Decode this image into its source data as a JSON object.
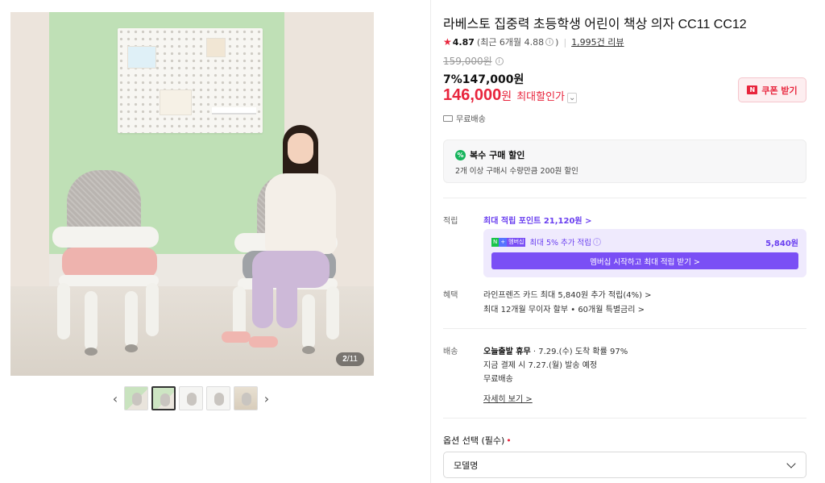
{
  "gallery": {
    "counter_current": "2",
    "counter_total": "/11",
    "prev_icon": "chevron-left-icon",
    "next_icon": "chevron-right-icon",
    "thumbnail_count": 5,
    "active_thumbnail": 2
  },
  "product": {
    "title": "라베스토 집중력 초등학생 어린이 책상 의자 CC11 CC12",
    "rating": "4.87",
    "rating_recent": "(최근 6개월 4.88",
    "rating_recent_close": ")",
    "review_count": "1,995건 리뷰",
    "original_price": "159,000원",
    "sale_price_line": "7%147,000원",
    "max_discount_price": "146,000",
    "max_discount_won": "원",
    "max_discount_label": "최대할인가",
    "coupon_button": "쿠폰 받기",
    "free_shipping": "무료배송"
  },
  "multi_discount": {
    "title": "복수 구매 할인",
    "description": "2개 이상 구매시 수량만큼 200원 할인"
  },
  "points": {
    "label": "적립",
    "max_points": "최대 적립 포인트 21,120원 >",
    "member_text": "최대 5% 추가 적립",
    "member_amount": "5,840원",
    "member_button": "멤버십 시작하고 최대 적립 받기 >",
    "badge_n": "N",
    "badge_plus": "+",
    "badge_member": "멤버십"
  },
  "benefits": {
    "label": "혜택",
    "line1": "라인프렌즈 카드 최대 5,840원 추가 적립(4%) >",
    "line2": "최대 12개월 무이자 할부 • 60개월 특별금리 >"
  },
  "delivery": {
    "label": "배송",
    "today_bold": "오늘출발 휴무",
    "today_rest": " · 7.29.(수) 도착 확률 97%",
    "line2": "지금 결제 시 7.27.(월) 발송 예정",
    "line3": "무료배송",
    "detail_link": "자세히 보기 >"
  },
  "options": {
    "label": "옵션 선택 (필수)",
    "required_mark": "•",
    "select_value": "모델명"
  },
  "colors": {
    "accent_red": "#e8243c",
    "purple": "#7a4ff5",
    "green": "#16b45c"
  }
}
